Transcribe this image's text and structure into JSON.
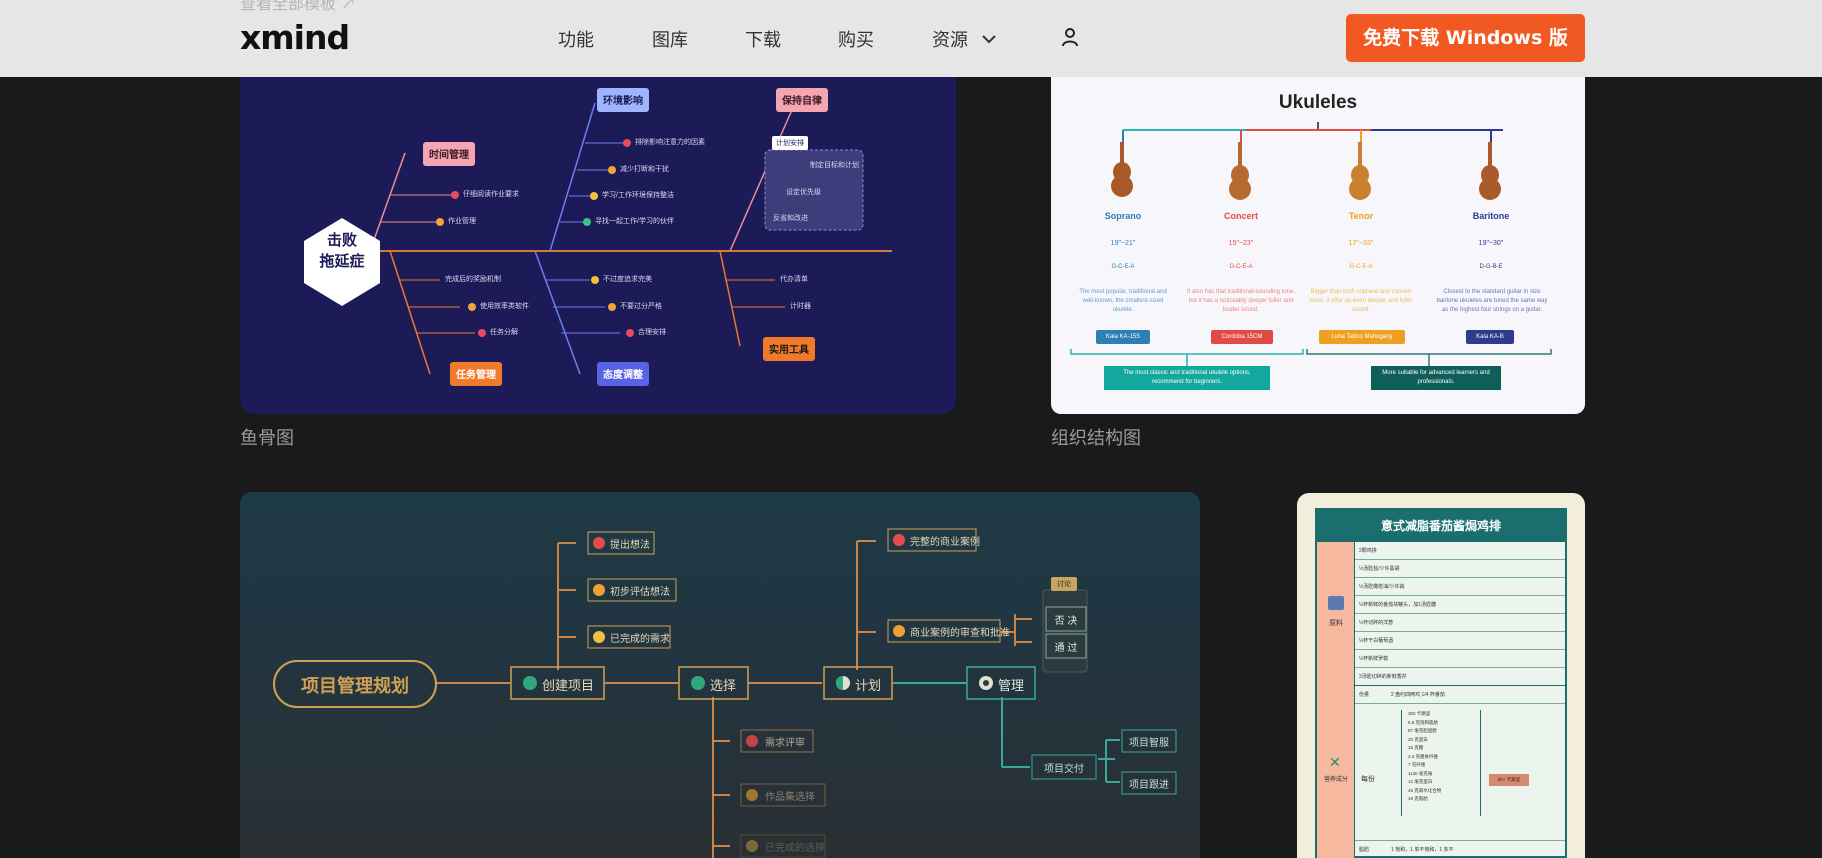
{
  "nav": {
    "logo": "xmind",
    "faded_text": "查看全部模板 ↗",
    "links": [
      "功能",
      "图库",
      "下载",
      "购买",
      "资源"
    ],
    "cta": "免费下载 Windows 版"
  },
  "cards": {
    "fishbone": {
      "caption": "鱼骨图",
      "center": [
        "击败",
        "拖延症"
      ],
      "top_heads": [
        "时间管理",
        "环境影响",
        "保持自律"
      ],
      "bottom_heads": [
        "任务管理",
        "态度调整",
        "实用工具"
      ],
      "time_items": [
        "仔细阅读作业要求",
        "作业管理"
      ],
      "env_items": [
        "排除影响注意力的因素",
        "减少打断和干扰",
        "学习/工作环境保持整洁",
        "寻找一起工作/学习的伙伴"
      ],
      "discipline_tag": "计划安排",
      "discipline_items": [
        "制定目标和计划",
        "设定优先级",
        "反省和改进"
      ],
      "task_items": [
        "完成后的奖励机制",
        "使用效率类软件",
        "任务分解"
      ],
      "attitude_items": [
        "不过度追求完美",
        "不要过分严格",
        "合理安排"
      ],
      "tool_items": [
        "代办清单",
        "计时器"
      ]
    },
    "org": {
      "caption": "组织结构图",
      "title": "Ukuleles",
      "types": [
        {
          "name": "Soprano",
          "size": "19\"~21\"",
          "tuning": "G-C-E-A",
          "desc": "The most popular, traditional and well-known, the smallest-sized ukulele.",
          "model": "Kala KA-15S",
          "color": "#2b7fb5"
        },
        {
          "name": "Concert",
          "size": "15\"~23\"",
          "tuning": "G-C-E-A",
          "desc": "It also has that traditional-sounding tone, but it has a noticeably deeper fuller and louder sound.",
          "model": "Cordoba 15CM",
          "color": "#e24a45"
        },
        {
          "name": "Tenor",
          "size": "17\"~33\"",
          "tuning": "G-C-E-A",
          "desc": "Bigger than both soprano and concert sizes, it offer an even deeper and fuller sound.",
          "model": "Luna Tattoo Mahogany",
          "color": "#f0a020"
        },
        {
          "name": "Baritone",
          "size": "19\"~30\"",
          "tuning": "D-G-B-E",
          "desc": "Closest to the standard guitar in size baritone ukuleles are tuned the same way as the highest four strings on a guitar.",
          "model": "Kala KA-B",
          "color": "#2f3a8f"
        }
      ],
      "note_left": "The most classic and traditional ukulele options, recommend for beginners.",
      "note_right": "More suitable for advanced learners and professionals."
    },
    "project": {
      "root": "项目管理规划",
      "stages": [
        "创建项目",
        "选择",
        "计划",
        "管理"
      ],
      "create_items": [
        "提出想法",
        "初步评估想法",
        "已完成的需求"
      ],
      "plan_items": [
        "完整的商业案例",
        "商业案例的审查和批准"
      ],
      "decision_tag": "讨论",
      "decision_items": [
        "否 决",
        "通 过"
      ],
      "select_items": [
        "需求评审",
        "作品集选择",
        "已完成的选择"
      ],
      "manage_item": "项目交付",
      "deliver_items": [
        "项目智服",
        "项目跟进"
      ]
    },
    "recipe": {
      "title": "意式减脂番茄酱焗鸡排",
      "section1": "原料",
      "section2": "营养成分",
      "rows": [
        "2颗鸡排",
        "½汤匙盐/少许黑胡",
        "½汤匙橄榄油/少许蒜",
        "½杯新鲜的番茄块罐头，加1汤匙糖",
        "½杯切碎的洋葱",
        "½杯干白葡萄酒",
        "½杯新鲜罗勒",
        "2汤匙切碎的新鲜香芹"
      ],
      "side1": "份量",
      "side1_val": "2 盘约四两鸡 1/4 杯番茄",
      "side2": "每份",
      "nutrients": [
        "350 卡路里",
        "5.5 克饱和脂肪",
        "97 毫克胆固醇",
        "20 克蛋白",
        "15 克糖",
        "3.4 克膳食纤维",
        "7 克纤维",
        "1130 毫克钠",
        "12 毫克蛋白",
        "46 克碳水化合物",
        "19 克脂肪"
      ],
      "badge": "50+ 卡路里",
      "footer_label": "脂肪",
      "footer_val": "1 饱和，1 单不饱和，1 多不"
    }
  }
}
